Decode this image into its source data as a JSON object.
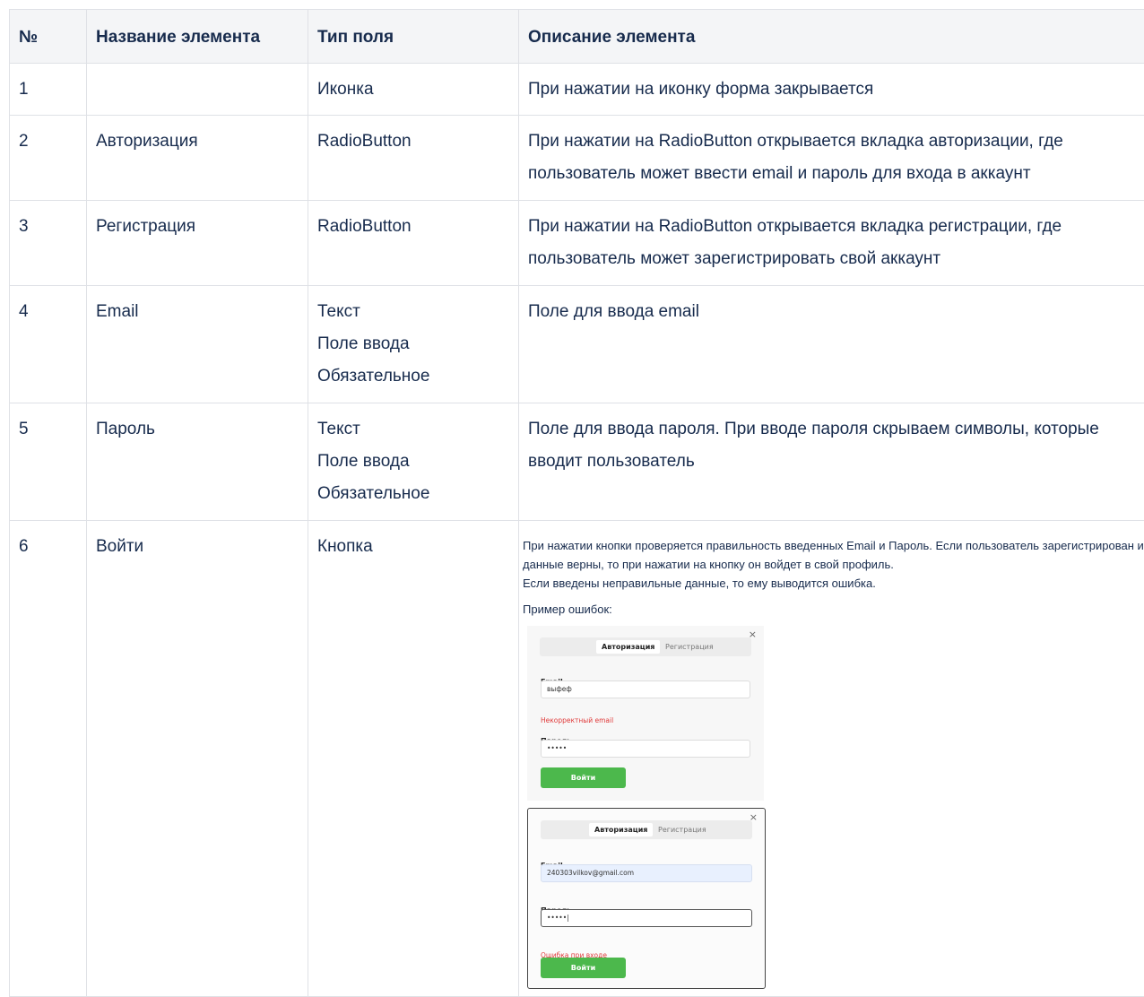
{
  "table": {
    "headers": [
      "№",
      "Название элемента",
      "Тип поля",
      "Описание элемента"
    ],
    "rows": [
      {
        "num": "1",
        "name": "",
        "type": [
          "Иконка"
        ],
        "desc": "При нажатии на иконку форма закрывается"
      },
      {
        "num": "2",
        "name": "Авторизация",
        "type": [
          "RadioButton"
        ],
        "desc": "При нажатии на RadioButton открывается вкладка авторизации, где пользователь может ввести email и пароль для входа в аккаунт"
      },
      {
        "num": "3",
        "name": "Регистрация",
        "type": [
          "RadioButton"
        ],
        "desc": "При нажатии на RadioButton открывается вкладка регистрации, где пользователь может зарегистрировать свой аккаунт"
      },
      {
        "num": "4",
        "name": "Email",
        "type": [
          "Текст",
          "Поле ввода",
          "Обязательное"
        ],
        "desc": "Поле для ввода email"
      },
      {
        "num": "5",
        "name": "Пароль",
        "type": [
          "Текст",
          "Поле ввода",
          "Обязательное"
        ],
        "desc": "Поле для ввода пароля. При вводе пароля скрываем символы, которые вводит пользователь"
      },
      {
        "num": "6",
        "name": "Войти",
        "type": [
          "Кнопка"
        ],
        "desc_lines": [
          "При нажатии кнопки проверяется правильность введенных Email и Пароль. Если пользователь зарегистрирован и данные верны, то при нажатии на кнопку он войдет в свой профиль.",
          "Если введены неправильные данные, то ему выводится ошибка."
        ],
        "example_label": "Пример ошибок:"
      }
    ]
  },
  "screenshot1": {
    "close": "×",
    "tab_login": "Авторизация",
    "tab_register": "Регистрация",
    "email_label": "Email",
    "email_value": "выфеф",
    "email_error": "Некорректный email",
    "password_label": "Пароль",
    "password_value": "•••••",
    "submit": "Войти"
  },
  "screenshot2": {
    "close": "×",
    "tab_login": "Авторизация",
    "tab_register": "Регистрация",
    "email_label": "Email",
    "email_value": "240303vilkov@gmail.com",
    "password_label": "Пароль",
    "password_value": "•••••|",
    "login_error": "Ошибка при входе",
    "submit": "Войти"
  },
  "colors": {
    "header_bg": "#f4f5f7",
    "border": "#dfe1e6",
    "text": "#172b4d",
    "button_green": "#4cb84c",
    "error_red": "#e03b3b"
  }
}
